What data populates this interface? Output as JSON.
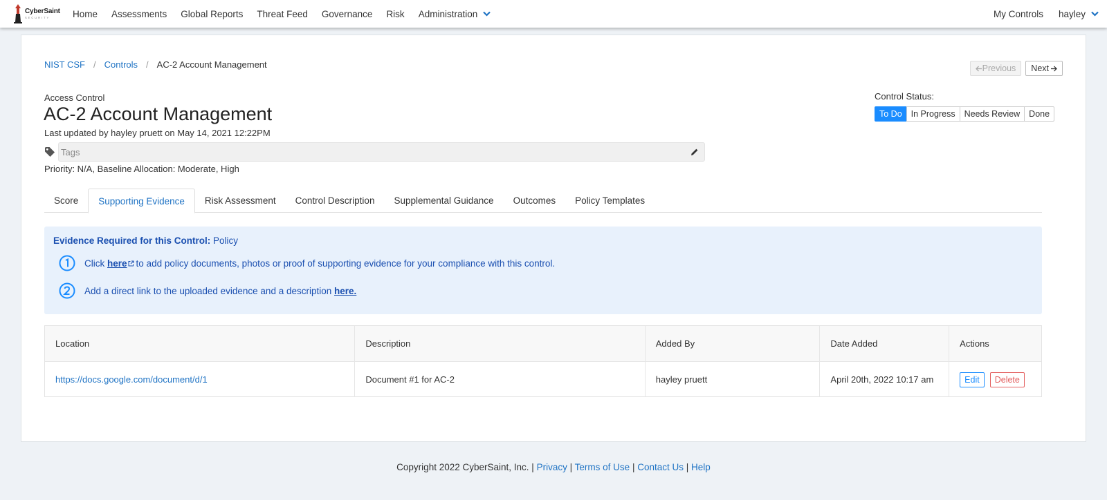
{
  "brand": {
    "name": "CyberSaint",
    "subtitle": "SECURITY"
  },
  "nav": {
    "items": [
      "Home",
      "Assessments",
      "Global Reports",
      "Threat Feed",
      "Governance",
      "Risk",
      "Administration"
    ],
    "my_controls": "My Controls",
    "user": "hayley"
  },
  "breadcrumb": {
    "framework": "NIST CSF",
    "controls": "Controls",
    "separator": "/",
    "current": "AC-2 Account Management"
  },
  "pager": {
    "previous": "Previous",
    "next": "Next"
  },
  "control": {
    "family": "Access Control",
    "title": "AC-2 Account Management",
    "updated": "Last updated by hayley pruett on May 14, 2021 12:22PM",
    "tags_placeholder": "Tags",
    "priority": "Priority: N/A, Baseline Allocation: Moderate, High"
  },
  "status": {
    "label": "Control Status:",
    "options": [
      "To Do",
      "In Progress",
      "Needs Review",
      "Done"
    ],
    "selected": "To Do"
  },
  "tabs": [
    "Score",
    "Supporting Evidence",
    "Risk Assessment",
    "Control Description",
    "Supplemental Guidance",
    "Outcomes",
    "Policy Templates"
  ],
  "active_tab": "Supporting Evidence",
  "evidence": {
    "heading": "Evidence Required for this Control:",
    "type": "Policy",
    "step1_prefix": "Click",
    "step1_link": "here",
    "step1_suffix": "to add policy documents, photos or proof of supporting evidence for your compliance with this control.",
    "step2_prefix": "Add a direct link to the uploaded evidence and a description",
    "step2_link": "here."
  },
  "table": {
    "columns": [
      "Location",
      "Description",
      "Added By",
      "Date Added",
      "Actions"
    ],
    "rows": [
      {
        "location": "https://docs.google.com/document/d/1",
        "description": "Document #1 for AC-2",
        "added_by": "hayley pruett",
        "date_added": "April 20th, 2022 10:17 am"
      }
    ],
    "edit_label": "Edit",
    "delete_label": "Delete"
  },
  "footer": {
    "copyright": "Copyright 2022 CyberSaint, Inc.",
    "sep": "|",
    "links": [
      "Privacy",
      "Terms of Use",
      "Contact Us",
      "Help"
    ]
  },
  "colors": {
    "accent": "#1a8cff",
    "link": "#1f73c4",
    "evidence_bg": "#e8f1fc",
    "evidence_text": "#1a4fb0",
    "danger": "#e35d5d"
  }
}
